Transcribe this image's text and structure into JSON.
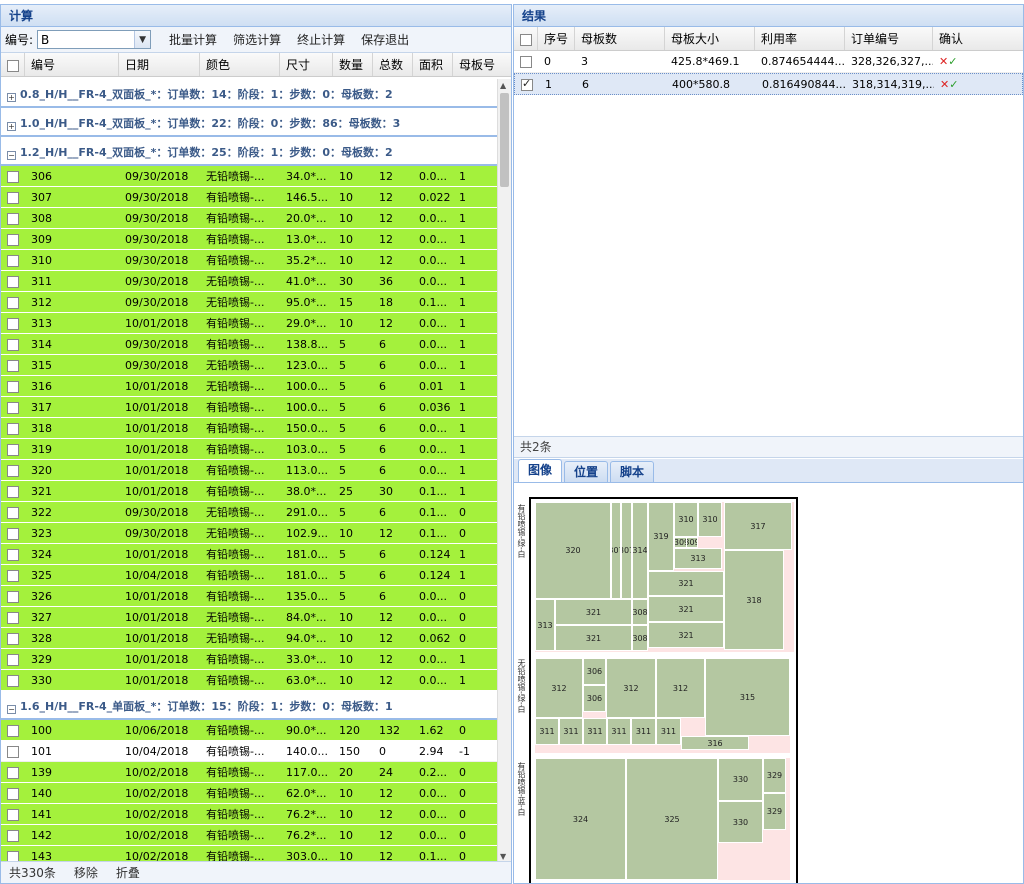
{
  "left": {
    "title": "计算",
    "toolbar": {
      "code_label": "编号:",
      "code_value": "B",
      "batch": "批量计算",
      "filter": "筛选计算",
      "stop": "终止计算",
      "save": "保存退出"
    },
    "columns": [
      "编号",
      "日期",
      "颜色",
      "尺寸",
      "数量",
      "总数",
      "面积",
      "母板号"
    ],
    "groups": [
      {
        "label": "0.8_H/H__FR-4_双面板_*：订单数：14：阶段：1：步数：0：母板数：2",
        "collapsed": true,
        "rows": []
      },
      {
        "label": "1.0_H/H__FR-4_双面板_*：订单数：22：阶段：0：步数：86：母板数：3",
        "collapsed": true,
        "rows": []
      },
      {
        "label": "1.2_H/H__FR-4_双面板_*：订单数：25：阶段：1：步数：0：母板数：2",
        "collapsed": false,
        "rows": [
          {
            "id": "306",
            "date": "09/30/2018",
            "color": "无铅喷锡-...",
            "size": "34.0*...",
            "qty": "10",
            "total": "12",
            "area": "0.0...",
            "board": "1",
            "green": true
          },
          {
            "id": "307",
            "date": "09/30/2018",
            "color": "有铅喷锡-...",
            "size": "146.5...",
            "qty": "10",
            "total": "12",
            "area": "0.022",
            "board": "1",
            "green": true
          },
          {
            "id": "308",
            "date": "09/30/2018",
            "color": "有铅喷锡-...",
            "size": "20.0*...",
            "qty": "10",
            "total": "12",
            "area": "0.0...",
            "board": "1",
            "green": true
          },
          {
            "id": "309",
            "date": "09/30/2018",
            "color": "有铅喷锡-...",
            "size": "13.0*...",
            "qty": "10",
            "total": "12",
            "area": "0.0...",
            "board": "1",
            "green": true
          },
          {
            "id": "310",
            "date": "09/30/2018",
            "color": "有铅喷锡-...",
            "size": "35.2*...",
            "qty": "10",
            "total": "12",
            "area": "0.0...",
            "board": "1",
            "green": true
          },
          {
            "id": "311",
            "date": "09/30/2018",
            "color": "无铅喷锡-...",
            "size": "41.0*...",
            "qty": "30",
            "total": "36",
            "area": "0.0...",
            "board": "1",
            "green": true
          },
          {
            "id": "312",
            "date": "09/30/2018",
            "color": "无铅喷锡-...",
            "size": "95.0*...",
            "qty": "15",
            "total": "18",
            "area": "0.1...",
            "board": "1",
            "green": true
          },
          {
            "id": "313",
            "date": "10/01/2018",
            "color": "有铅喷锡-...",
            "size": "29.0*...",
            "qty": "10",
            "total": "12",
            "area": "0.0...",
            "board": "1",
            "green": true
          },
          {
            "id": "314",
            "date": "09/30/2018",
            "color": "有铅喷锡-...",
            "size": "138.8...",
            "qty": "5",
            "total": "6",
            "area": "0.0...",
            "board": "1",
            "green": true
          },
          {
            "id": "315",
            "date": "09/30/2018",
            "color": "无铅喷锡-...",
            "size": "123.0...",
            "qty": "5",
            "total": "6",
            "area": "0.0...",
            "board": "1",
            "green": true
          },
          {
            "id": "316",
            "date": "10/01/2018",
            "color": "无铅喷锡-...",
            "size": "100.0...",
            "qty": "5",
            "total": "6",
            "area": "0.01",
            "board": "1",
            "green": true
          },
          {
            "id": "317",
            "date": "10/01/2018",
            "color": "有铅喷锡-...",
            "size": "100.0...",
            "qty": "5",
            "total": "6",
            "area": "0.036",
            "board": "1",
            "green": true
          },
          {
            "id": "318",
            "date": "10/01/2018",
            "color": "有铅喷锡-...",
            "size": "150.0...",
            "qty": "5",
            "total": "6",
            "area": "0.0...",
            "board": "1",
            "green": true
          },
          {
            "id": "319",
            "date": "10/01/2018",
            "color": "有铅喷锡-...",
            "size": "103.0...",
            "qty": "5",
            "total": "6",
            "area": "0.0...",
            "board": "1",
            "green": true
          },
          {
            "id": "320",
            "date": "10/01/2018",
            "color": "有铅喷锡-...",
            "size": "113.0...",
            "qty": "5",
            "total": "6",
            "area": "0.0...",
            "board": "1",
            "green": true
          },
          {
            "id": "321",
            "date": "10/01/2018",
            "color": "有铅喷锡-...",
            "size": "38.0*...",
            "qty": "25",
            "total": "30",
            "area": "0.1...",
            "board": "1",
            "green": true
          },
          {
            "id": "322",
            "date": "09/30/2018",
            "color": "无铅喷锡-...",
            "size": "291.0...",
            "qty": "5",
            "total": "6",
            "area": "0.1...",
            "board": "0",
            "green": true
          },
          {
            "id": "323",
            "date": "09/30/2018",
            "color": "无铅喷锡-...",
            "size": "102.9...",
            "qty": "10",
            "total": "12",
            "area": "0.1...",
            "board": "0",
            "green": true
          },
          {
            "id": "324",
            "date": "10/01/2018",
            "color": "有铅喷锡-...",
            "size": "181.0...",
            "qty": "5",
            "total": "6",
            "area": "0.124",
            "board": "1",
            "green": true
          },
          {
            "id": "325",
            "date": "10/04/2018",
            "color": "有铅喷锡-...",
            "size": "181.0...",
            "qty": "5",
            "total": "6",
            "area": "0.124",
            "board": "1",
            "green": true
          },
          {
            "id": "326",
            "date": "10/01/2018",
            "color": "有铅喷锡-...",
            "size": "135.0...",
            "qty": "5",
            "total": "6",
            "area": "0.0...",
            "board": "0",
            "green": true
          },
          {
            "id": "327",
            "date": "10/01/2018",
            "color": "无铅喷锡-...",
            "size": "84.0*...",
            "qty": "10",
            "total": "12",
            "area": "0.0...",
            "board": "0",
            "green": true
          },
          {
            "id": "328",
            "date": "10/01/2018",
            "color": "无铅喷锡-...",
            "size": "94.0*...",
            "qty": "10",
            "total": "12",
            "area": "0.062",
            "board": "0",
            "green": true
          },
          {
            "id": "329",
            "date": "10/01/2018",
            "color": "有铅喷锡-...",
            "size": "33.0*...",
            "qty": "10",
            "total": "12",
            "area": "0.0...",
            "board": "1",
            "green": true
          },
          {
            "id": "330",
            "date": "10/01/2018",
            "color": "有铅喷锡-...",
            "size": "63.0*...",
            "qty": "10",
            "total": "12",
            "area": "0.0...",
            "board": "1",
            "green": true
          }
        ]
      },
      {
        "label": "1.6_H/H__FR-4_单面板_*：订单数：15：阶段：1：步数：0：母板数：1",
        "collapsed": false,
        "rows": [
          {
            "id": "100",
            "date": "10/06/2018",
            "color": "有铅喷锡-...",
            "size": "90.0*...",
            "qty": "120",
            "total": "132",
            "area": "1.62",
            "board": "0",
            "green": true
          },
          {
            "id": "101",
            "date": "10/04/2018",
            "color": "有铅喷锡-...",
            "size": "140.0...",
            "qty": "150",
            "total": "0",
            "area": "2.94",
            "board": "-1",
            "green": false
          },
          {
            "id": "139",
            "date": "10/02/2018",
            "color": "有铅喷锡-...",
            "size": "117.0...",
            "qty": "20",
            "total": "24",
            "area": "0.2...",
            "board": "0",
            "green": true
          },
          {
            "id": "140",
            "date": "10/02/2018",
            "color": "有铅喷锡-...",
            "size": "62.0*...",
            "qty": "10",
            "total": "12",
            "area": "0.0...",
            "board": "0",
            "green": true
          },
          {
            "id": "141",
            "date": "10/02/2018",
            "color": "有铅喷锡-...",
            "size": "76.2*...",
            "qty": "10",
            "total": "12",
            "area": "0.0...",
            "board": "0",
            "green": true
          },
          {
            "id": "142",
            "date": "10/02/2018",
            "color": "有铅喷锡-...",
            "size": "76.2*...",
            "qty": "10",
            "total": "12",
            "area": "0.0...",
            "board": "0",
            "green": true
          },
          {
            "id": "143",
            "date": "10/02/2018",
            "color": "有铅喷锡-...",
            "size": "303.0...",
            "qty": "10",
            "total": "12",
            "area": "0.1...",
            "board": "0",
            "green": true
          }
        ]
      }
    ],
    "footer": {
      "count": "共330条",
      "remove": "移除",
      "fold": "折叠"
    }
  },
  "right": {
    "title": "结果",
    "columns": [
      "序号",
      "母板数",
      "母板大小",
      "利用率",
      "订单编号",
      "确认"
    ],
    "rows": [
      {
        "idx": "0",
        "boards": "3",
        "size": "425.8*469.1",
        "rate": "0.874654444...",
        "orders": "328,326,327,...",
        "checked": false
      },
      {
        "idx": "1",
        "boards": "6",
        "size": "400*580.8",
        "rate": "0.816490844...",
        "orders": "318,314,319,...",
        "checked": true
      }
    ],
    "count": "共2条",
    "tabs": [
      "图像",
      "位置",
      "脚本"
    ],
    "sheet_labels": [
      "有铅喷锡-绿-白",
      "无铅喷锡-绿-白",
      "有铅喷锡-蓝-白"
    ],
    "pieces": [
      "320",
      "307",
      "307",
      "314",
      "319",
      "310",
      "310",
      "309",
      "309",
      "317",
      "313",
      "321",
      "313",
      "321",
      "308",
      "321",
      "318",
      "321",
      "308",
      "321",
      "306",
      "312",
      "306",
      "312",
      "312",
      "315",
      "311",
      "311",
      "311",
      "311",
      "311",
      "311",
      "316",
      "324",
      "325",
      "330",
      "329",
      "330",
      "329"
    ]
  }
}
